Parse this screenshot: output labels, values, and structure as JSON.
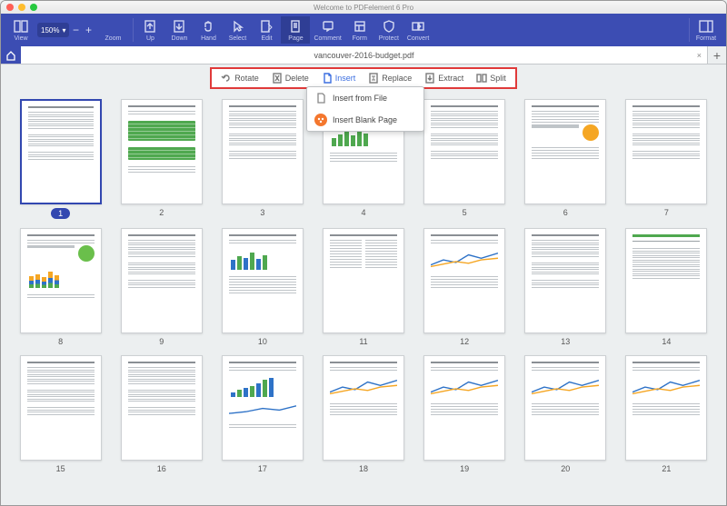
{
  "app": {
    "title": "Welcome to PDFelement 6 Pro"
  },
  "toolbar": {
    "view": "View",
    "zoom": "Zoom",
    "zoom_value": "150%",
    "up": "Up",
    "down": "Down",
    "hand": "Hand",
    "select": "Select",
    "edit": "Edit",
    "page": "Page",
    "comment": "Comment",
    "form": "Form",
    "protect": "Protect",
    "convert": "Convert",
    "format": "Format"
  },
  "tabs": {
    "file": "vancouver-2016-budget.pdf"
  },
  "pageops": {
    "rotate": "Rotate",
    "delete": "Delete",
    "insert": "Insert",
    "replace": "Replace",
    "extract": "Extract",
    "split": "Split"
  },
  "dropdown": {
    "from_file": "Insert from File",
    "blank": "Insert Blank Page"
  },
  "pages": [
    {
      "n": "1",
      "sel": true
    },
    {
      "n": "2"
    },
    {
      "n": "3"
    },
    {
      "n": "4"
    },
    {
      "n": "5"
    },
    {
      "n": "6"
    },
    {
      "n": "7"
    },
    {
      "n": "8"
    },
    {
      "n": "9"
    },
    {
      "n": "10"
    },
    {
      "n": "11"
    },
    {
      "n": "12"
    },
    {
      "n": "13"
    },
    {
      "n": "14"
    },
    {
      "n": "15"
    },
    {
      "n": "16"
    },
    {
      "n": "17"
    },
    {
      "n": "18"
    },
    {
      "n": "19"
    },
    {
      "n": "20"
    },
    {
      "n": "21"
    }
  ]
}
